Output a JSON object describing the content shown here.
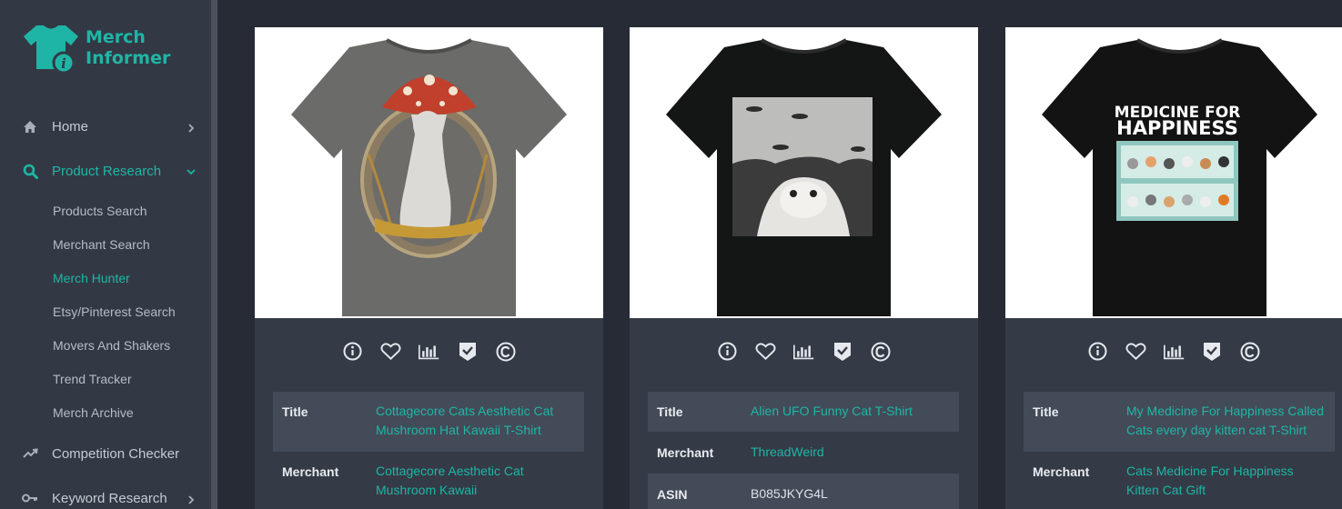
{
  "app": {
    "brand": {
      "line1": "Merch",
      "line2": "Informer"
    },
    "colors": {
      "accent": "#1fb5a6",
      "sidebar": "#333944",
      "background": "#272b35",
      "card": "#343b46"
    }
  },
  "sidebar": {
    "items": [
      {
        "label": "Home",
        "icon": "home-icon"
      },
      {
        "label": "Product Research",
        "icon": "search-icon"
      },
      {
        "label": "Competition Checker",
        "icon": "trend-icon"
      },
      {
        "label": "Keyword Research",
        "icon": "key-icon"
      }
    ],
    "subitems": [
      {
        "label": "Products Search"
      },
      {
        "label": "Merchant Search"
      },
      {
        "label": "Merch Hunter"
      },
      {
        "label": "Etsy/Pinterest Search"
      },
      {
        "label": "Movers And Shakers"
      },
      {
        "label": "Trend Tracker"
      },
      {
        "label": "Merch Archive"
      }
    ]
  },
  "actions": [
    "info-icon",
    "heart-icon",
    "bar-chart-icon",
    "badge-check-icon",
    "copyright-icon"
  ],
  "products": [
    {
      "title_label": "Title",
      "title": "Cottagecore Cats Aesthetic Cat Mushroom Hat Kawaii T-Shirt",
      "merchant_label": "Merchant",
      "merchant": "Cottagecore Aesthetic Cat Mushroom Kawaii",
      "shirt_color": "#6b6b69"
    },
    {
      "title_label": "Title",
      "title": "Alien UFO Funny Cat T-Shirt",
      "merchant_label": "Merchant",
      "merchant": "ThreadWeird",
      "asin_label": "ASIN",
      "asin": "B085JKYG4L",
      "shirt_color": "#141515"
    },
    {
      "title_label": "Title",
      "title": "My Medicine For Happiness Called Cats every day kitten cat T-Shirt",
      "merchant_label": "Merchant",
      "merchant": "Cats Medicine For Happiness Kitten Cat Gift",
      "shirt_color": "#131313",
      "graphic_text_1": "MEDICINE FOR",
      "graphic_text_2": "HAPPINESS"
    }
  ]
}
